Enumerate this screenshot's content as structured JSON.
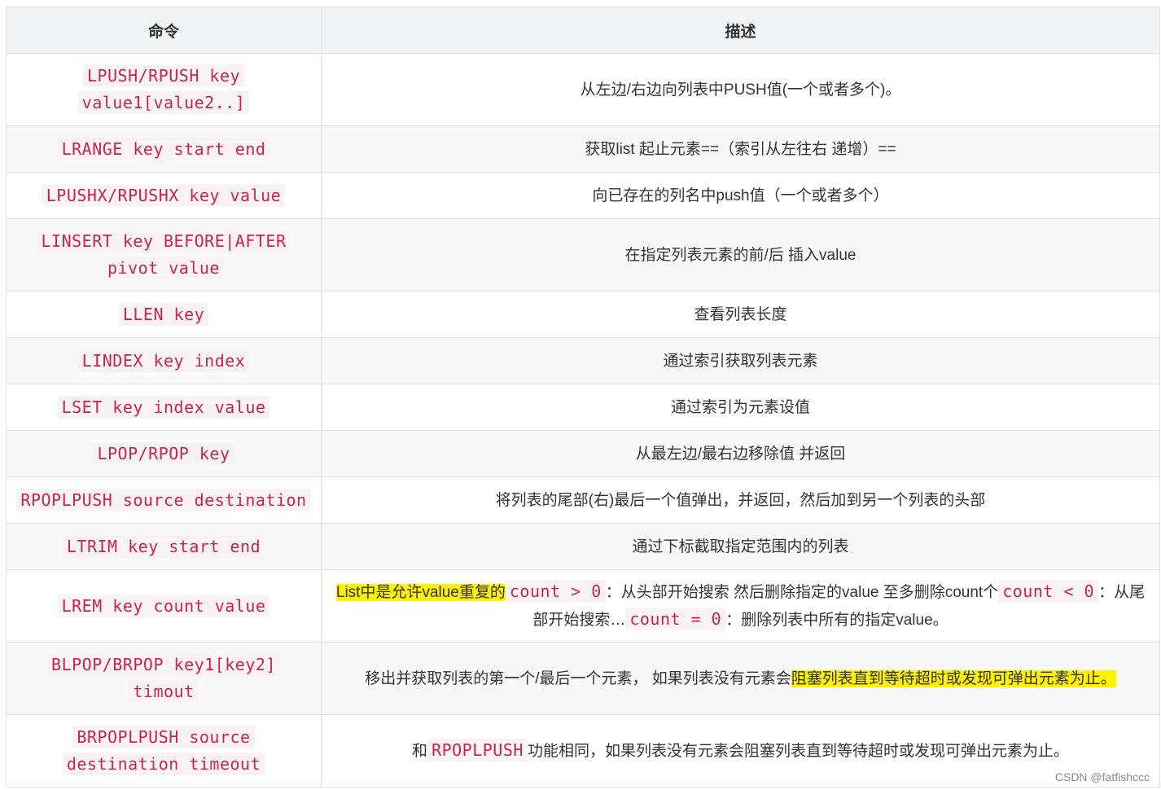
{
  "headers": {
    "command": "命令",
    "description": "描述"
  },
  "rows": [
    {
      "cmd": "LPUSH/RPUSH key value1[value2..]",
      "desc": "从左边/右边向列表中PUSH值(一个或者多个)。"
    },
    {
      "cmd": "LRANGE key start end",
      "desc": "获取list 起止元素==（索引从左往右 递增）=="
    },
    {
      "cmd": "LPUSHX/RPUSHX key value",
      "desc": "向已存在的列名中push值（一个或者多个）"
    },
    {
      "cmd": "LINSERT key BEFORE|AFTER pivot value",
      "desc": "在指定列表元素的前/后 插入value"
    },
    {
      "cmd": "LLEN key",
      "desc": "查看列表长度"
    },
    {
      "cmd": "LINDEX key index",
      "desc": "通过索引获取列表元素"
    },
    {
      "cmd": "LSET key index value",
      "desc": "通过索引为元素设值"
    },
    {
      "cmd": "LPOP/RPOP key",
      "desc": "从最左边/最右边移除值 并返回"
    },
    {
      "cmd": "RPOPLPUSH source destination",
      "desc": "将列表的尾部(右)最后一个值弹出，并返回，然后加到另一个列表的头部"
    },
    {
      "cmd": "LTRIM key start end",
      "desc": "通过下标截取指定范围内的列表"
    },
    {
      "cmd": "LREM key count value",
      "desc_highlight": "List中是允许value重复的",
      "desc_code1": "count > 0",
      "desc_text1": "：从头部开始搜索 然后删除指定的value 至多删除count个",
      "desc_code2": "count < 0",
      "desc_text2": "：从尾部开始搜索…",
      "desc_code3": "count = 0",
      "desc_text3": "：删除列表中所有的指定value。"
    },
    {
      "cmd": "BLPOP/BRPOP key1[key2] timout",
      "desc_prefix": "移出并获取列表的第一个/最后一个元素， 如果列表没有元素会",
      "desc_highlight": "阻塞列表直到等待超时或发现可弹出元素为止。"
    },
    {
      "cmd": "BRPOPLPUSH source destination timeout",
      "desc_prefix": "和",
      "desc_code": "RPOPLPUSH",
      "desc_suffix": "功能相同，如果列表没有元素会阻塞列表直到等待超时或发现可弹出元素为止。"
    }
  ],
  "watermark": "CSDN @fatfishccc",
  "colors": {
    "code_text": "#c7254e",
    "code_bg": "#f9f2f4",
    "header_bg": "#eff3f5",
    "highlight": "#fff200",
    "border": "#dfe2e5"
  }
}
